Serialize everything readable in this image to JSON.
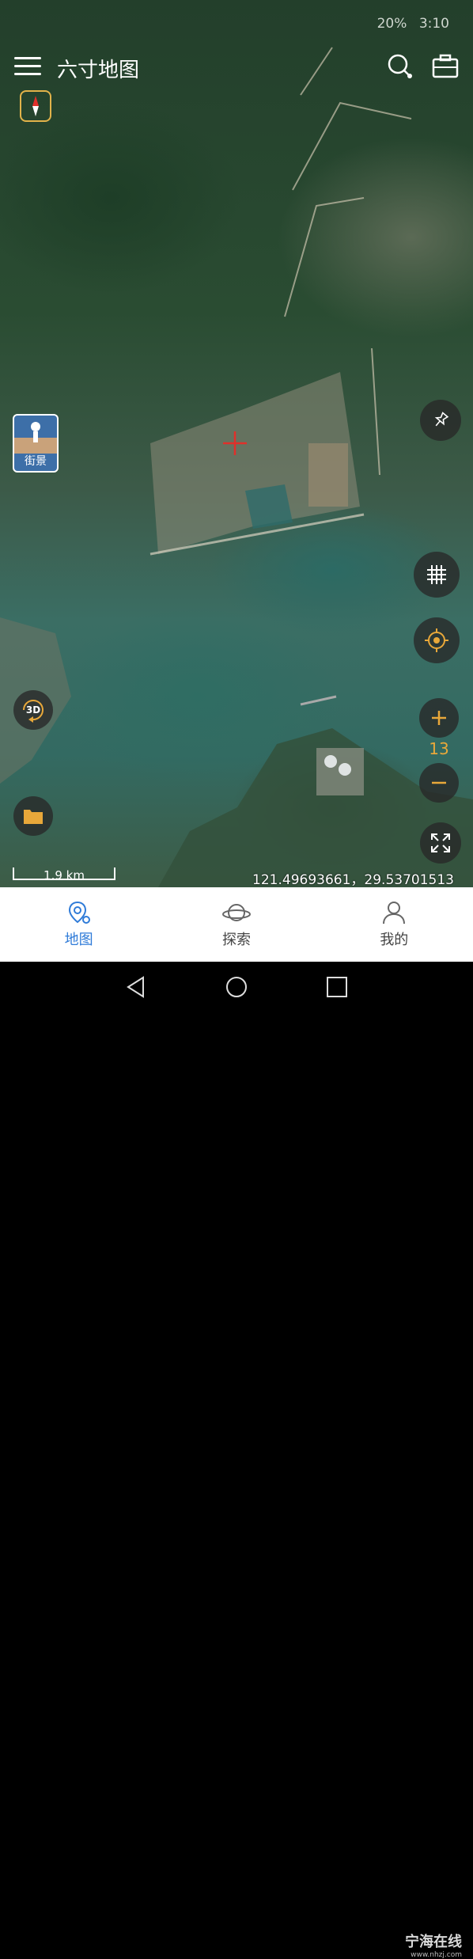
{
  "status_bar": {
    "battery": "20%",
    "time": "3:10"
  },
  "app": {
    "title": "六寸地图"
  },
  "map": {
    "street_view_label": "街景",
    "mode_3d_label": "3D",
    "zoom_level": "13",
    "scale_label": "1.9 km",
    "coordinates": "121.49693661，29.53701513"
  },
  "nav": {
    "items": [
      {
        "label": "地图",
        "icon": "map-pin-icon",
        "active": true
      },
      {
        "label": "探索",
        "icon": "planet-icon",
        "active": false
      },
      {
        "label": "我的",
        "icon": "user-icon",
        "active": false
      }
    ]
  },
  "watermark": {
    "text": "宁海在线",
    "url": "www.nhzj.com"
  },
  "colors": {
    "accent": "#2f7bd8",
    "zoom_level": "#e8a83a",
    "compass_border": "#e2b34a"
  }
}
